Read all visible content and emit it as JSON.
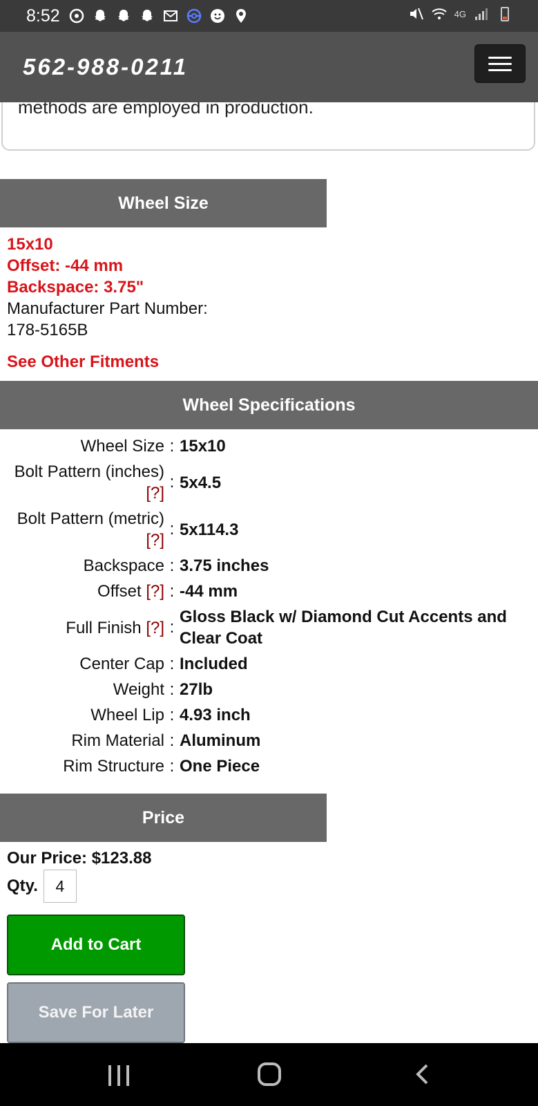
{
  "status_bar": {
    "time": "8:52",
    "network": "4G",
    "icons": [
      "sync-icon",
      "snapchat-icon",
      "snapchat-icon",
      "snapchat-icon",
      "gmail-icon",
      "pokeball-icon",
      "smiley-icon",
      "location-icon",
      "mute-icon",
      "wifi-icon",
      "signal-icon",
      "battery-icon"
    ]
  },
  "header": {
    "phone": "562-988-0211",
    "menu_icon": "hamburger-icon"
  },
  "description": {
    "text": "methods are employed in production."
  },
  "wheel_size": {
    "heading": "Wheel Size",
    "size": "15x10",
    "offset": "Offset: -44 mm",
    "backspace": "Backspace: 3.75\"",
    "mpn_label": "Manufacturer Part Number:",
    "mpn_value": "178-5165B",
    "fitments_link": "See Other Fitments"
  },
  "specifications": {
    "heading": "Wheel Specifications",
    "help_marker": "[?]",
    "rows": [
      {
        "label": "Wheel Size",
        "value": "15x10"
      },
      {
        "label": "Bolt Pattern (inches)",
        "value": "5x4.5"
      },
      {
        "label": "Bolt Pattern (metric)",
        "value": "5x114.3"
      },
      {
        "label": "Backspace",
        "value": "3.75 inches"
      },
      {
        "label": "Offset",
        "value": "-44 mm"
      },
      {
        "label": "Full Finish",
        "value": "Gloss Black w/ Diamond Cut Accents and Clear Coat"
      },
      {
        "label": "Center Cap",
        "value": "Included"
      },
      {
        "label": "Weight",
        "value": "27lb"
      },
      {
        "label": "Wheel Lip",
        "value": "4.93 inch"
      },
      {
        "label": "Rim Material",
        "value": "Aluminum"
      },
      {
        "label": "Rim Structure",
        "value": "One Piece"
      }
    ]
  },
  "price": {
    "heading": "Price",
    "our_price": "Our Price: $123.88",
    "qty_label": "Qty.",
    "qty_value": "4",
    "add_to_cart": "Add to Cart",
    "save_for_later": "Save For Later"
  },
  "colors": {
    "header_bg": "#525252",
    "section_bg": "#686868",
    "accent_red": "#d8141a",
    "cart_green": "#009a00",
    "save_gray": "#9ea6b0"
  }
}
